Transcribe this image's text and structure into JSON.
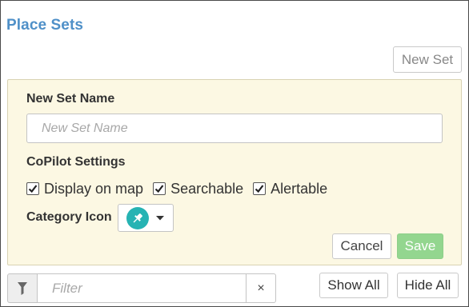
{
  "header": {
    "title": "Place Sets"
  },
  "toolbar": {
    "new_set_label": "New Set"
  },
  "editor": {
    "name_label": "New Set Name",
    "name_placeholder": "New Set Name",
    "copilot_label": "CoPilot Settings",
    "options": [
      {
        "label": "Display on map",
        "checked": true
      },
      {
        "label": "Searchable",
        "checked": true
      },
      {
        "label": "Alertable",
        "checked": true
      }
    ],
    "category_label": "Category Icon",
    "category_icon": "pushpin-icon",
    "category_icon_color": "#26b3b3",
    "cancel_label": "Cancel",
    "save_label": "Save",
    "save_color": "#93d68f"
  },
  "footer": {
    "filter_placeholder": "Filter",
    "clear_label": "×",
    "show_all_label": "Show All",
    "hide_all_label": "Hide All"
  }
}
